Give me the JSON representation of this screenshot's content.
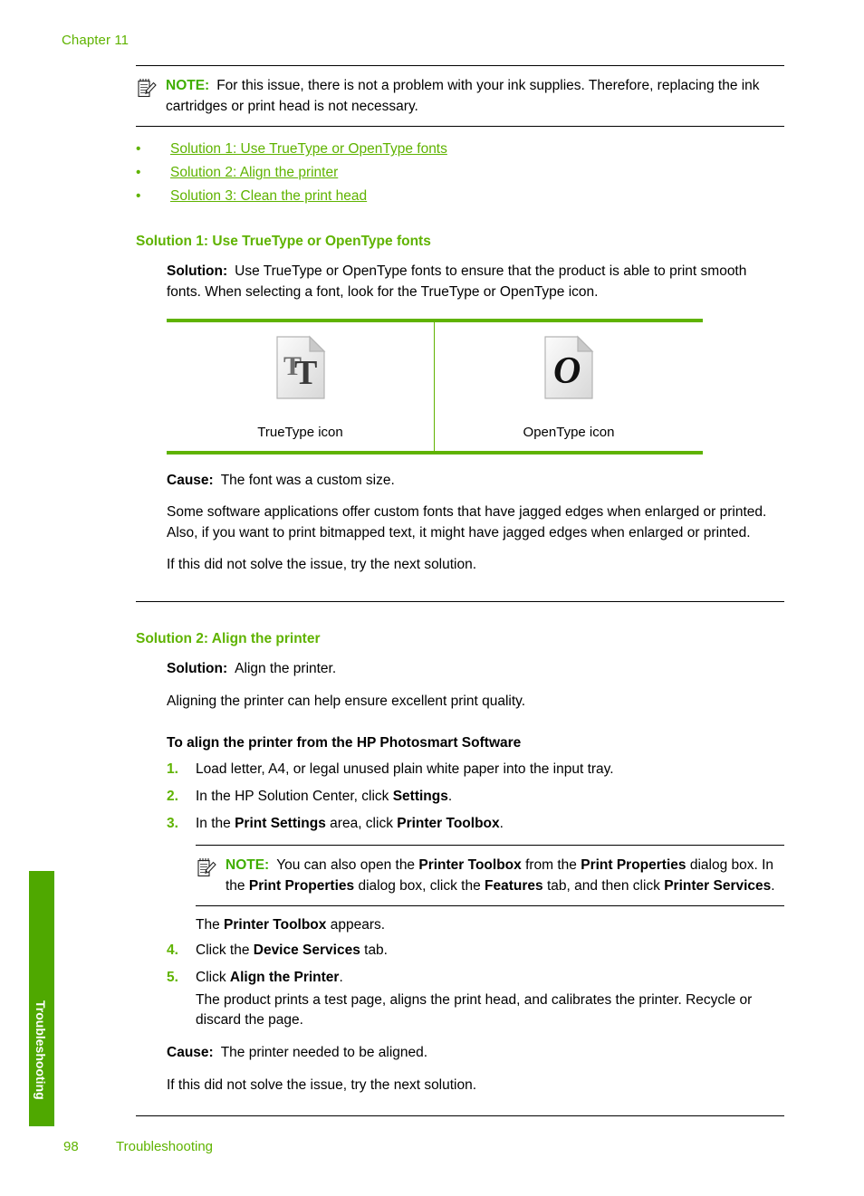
{
  "document": {
    "chapter": "Chapter 11",
    "accent_green": "#5fb300",
    "note_green": "#3fae00",
    "tab_green": "#4fa800"
  },
  "top_note": {
    "icon": "note-pencil-icon",
    "label": "NOTE:",
    "text": "For this issue, there is not a problem with your ink supplies. Therefore, replacing the ink cartridges or print head is not necessary."
  },
  "solution_links": [
    {
      "bullet": "•",
      "label": "Solution 1: Use TrueType or OpenType fonts"
    },
    {
      "bullet": "•",
      "label": "Solution 2: Align the printer"
    },
    {
      "bullet": "•",
      "label": "Solution 3: Clean the print head"
    }
  ],
  "solution1": {
    "heading": "Solution 1: Use TrueType or OpenType fonts",
    "solution_label": "Solution:",
    "solution_text": "Use TrueType or OpenType fonts to ensure that the product is able to print smooth fonts. When selecting a font, look for the TrueType or OpenType icon.",
    "icon_table": {
      "left": {
        "icon": "truetype-font-file-icon",
        "caption": "TrueType icon"
      },
      "right": {
        "icon": "opentype-font-file-icon",
        "caption": "OpenType icon"
      }
    },
    "cause_label": "Cause:",
    "cause_text": "The font was a custom size.",
    "detail_text": "Some software applications offer custom fonts that have jagged edges when enlarged or printed. Also, if you want to print bitmapped text, it might have jagged edges when enlarged or printed.",
    "next_text": "If this did not solve the issue, try the next solution."
  },
  "solution2": {
    "heading": "Solution 2: Align the printer",
    "solution_label": "Solution:",
    "solution_text": "Align the printer.",
    "intro_text": "Aligning the printer can help ensure excellent print quality.",
    "procedure_heading": "To align the printer from the HP Photosmart Software",
    "steps": [
      {
        "num": "1.",
        "parts": [
          {
            "t": "Load letter, A4, or legal unused plain white paper into the input tray.",
            "b": false
          }
        ]
      },
      {
        "num": "2.",
        "parts": [
          {
            "t": "In the HP Solution Center, click ",
            "b": false
          },
          {
            "t": "Settings",
            "b": true
          },
          {
            "t": ".",
            "b": false
          }
        ]
      },
      {
        "num": "3.",
        "parts": [
          {
            "t": "In the ",
            "b": false
          },
          {
            "t": "Print Settings",
            "b": true
          },
          {
            "t": " area, click ",
            "b": false
          },
          {
            "t": "Printer Toolbox",
            "b": true
          },
          {
            "t": ".",
            "b": false
          }
        ]
      }
    ],
    "inline_note": {
      "icon": "note-pencil-icon",
      "label": "NOTE:",
      "parts": [
        {
          "t": "You can also open the ",
          "b": false
        },
        {
          "t": "Printer Toolbox",
          "b": true
        },
        {
          "t": " from the ",
          "b": false
        },
        {
          "t": "Print Properties",
          "b": true
        },
        {
          "t": " dialog box. In the ",
          "b": false
        },
        {
          "t": "Print Properties",
          "b": true
        },
        {
          "t": " dialog box, click the ",
          "b": false
        },
        {
          "t": "Features",
          "b": true
        },
        {
          "t": " tab, and then click ",
          "b": false
        },
        {
          "t": "Printer Services",
          "b": true
        },
        {
          "t": ".",
          "b": false
        }
      ]
    },
    "after_note_parts": [
      {
        "t": "The ",
        "b": false
      },
      {
        "t": "Printer Toolbox",
        "b": true
      },
      {
        "t": " appears.",
        "b": false
      }
    ],
    "steps2": [
      {
        "num": "4.",
        "parts": [
          {
            "t": "Click the ",
            "b": false
          },
          {
            "t": "Device Services",
            "b": true
          },
          {
            "t": " tab.",
            "b": false
          }
        ],
        "sub": ""
      },
      {
        "num": "5.",
        "parts": [
          {
            "t": "Click ",
            "b": false
          },
          {
            "t": "Align the Printer",
            "b": true
          },
          {
            "t": ".",
            "b": false
          }
        ],
        "sub": "The product prints a test page, aligns the print head, and calibrates the printer. Recycle or discard the page."
      }
    ],
    "cause_label": "Cause:",
    "cause_text": "The printer needed to be aligned.",
    "next_text": "If this did not solve the issue, try the next solution."
  },
  "side_tab": {
    "label": "Troubleshooting"
  },
  "footer": {
    "page_number": "98",
    "section": "Troubleshooting"
  }
}
